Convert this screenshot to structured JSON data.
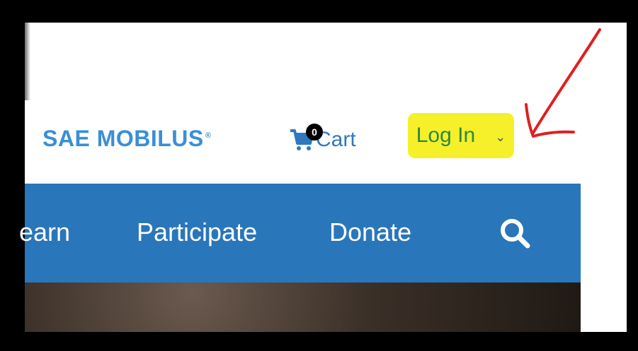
{
  "header": {
    "brand": "SAE MOBILUS",
    "brand_mark": "®",
    "cart": {
      "label": "Cart",
      "count": "0"
    },
    "login": {
      "label": "Log In",
      "caret": "⌄"
    }
  },
  "nav": {
    "items": [
      "earn",
      "Participate",
      "Donate"
    ]
  },
  "colors": {
    "brand": "#3a8fd4",
    "nav_bg": "#2a76ba",
    "highlight": "#f6f02a",
    "annotation": "#e02020"
  }
}
